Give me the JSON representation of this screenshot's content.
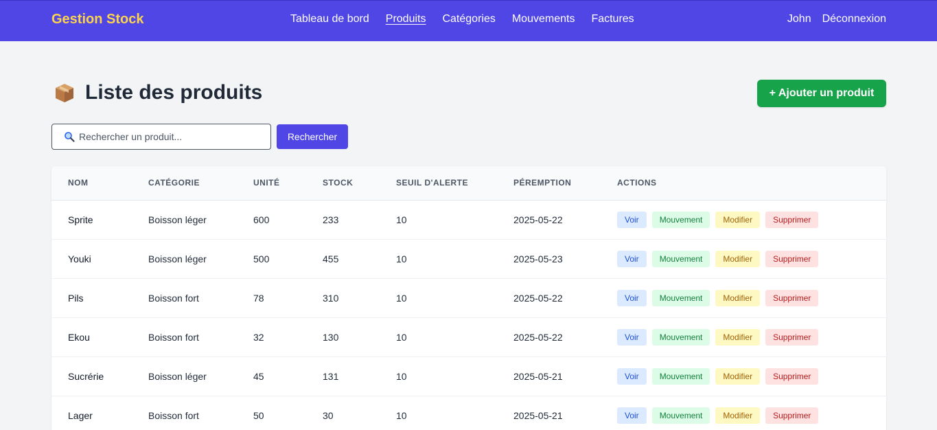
{
  "nav": {
    "brand": "Gestion Stock",
    "links": [
      "Tableau de bord",
      "Produits",
      "Catégories",
      "Mouvements",
      "Factures"
    ],
    "active": "Produits",
    "user": "John",
    "logout": "Déconnexion"
  },
  "page": {
    "icon": "package-box-icon",
    "title": "Liste des produits",
    "add_button": "+ Ajouter un produit"
  },
  "search": {
    "icon": "search-icon",
    "placeholder": "Rechercher un produit...",
    "button": "Rechercher"
  },
  "table": {
    "headers": [
      "Nom",
      "Catégorie",
      "Unité",
      "Stock",
      "Seuil d'alerte",
      "Péremption",
      "Actions"
    ],
    "rows": [
      {
        "nom": "Sprite",
        "categorie": "Boisson léger",
        "unite": "600",
        "stock": "233",
        "seuil": "10",
        "peremption": "2025-05-22"
      },
      {
        "nom": "Youki",
        "categorie": "Boisson léger",
        "unite": "500",
        "stock": "455",
        "seuil": "10",
        "peremption": "2025-05-23"
      },
      {
        "nom": "Pils",
        "categorie": "Boisson fort",
        "unite": "78",
        "stock": "310",
        "seuil": "10",
        "peremption": "2025-05-22"
      },
      {
        "nom": "Ekou",
        "categorie": "Boisson fort",
        "unite": "32",
        "stock": "130",
        "seuil": "10",
        "peremption": "2025-05-22"
      },
      {
        "nom": "Sucrérie",
        "categorie": "Boisson léger",
        "unite": "45",
        "stock": "131",
        "seuil": "10",
        "peremption": "2025-05-21"
      },
      {
        "nom": "Lager",
        "categorie": "Boisson fort",
        "unite": "50",
        "stock": "30",
        "seuil": "10",
        "peremption": "2025-05-21"
      }
    ],
    "actions": {
      "voir": "Voir",
      "mouvement": "Mouvement",
      "modifier": "Modifier",
      "supprimer": "Supprimer"
    }
  },
  "colors": {
    "nav_bg": "#4f46e5",
    "brand": "#fcd34d",
    "add_button": "#16a34a",
    "page_bg": "#f3f4f6"
  }
}
